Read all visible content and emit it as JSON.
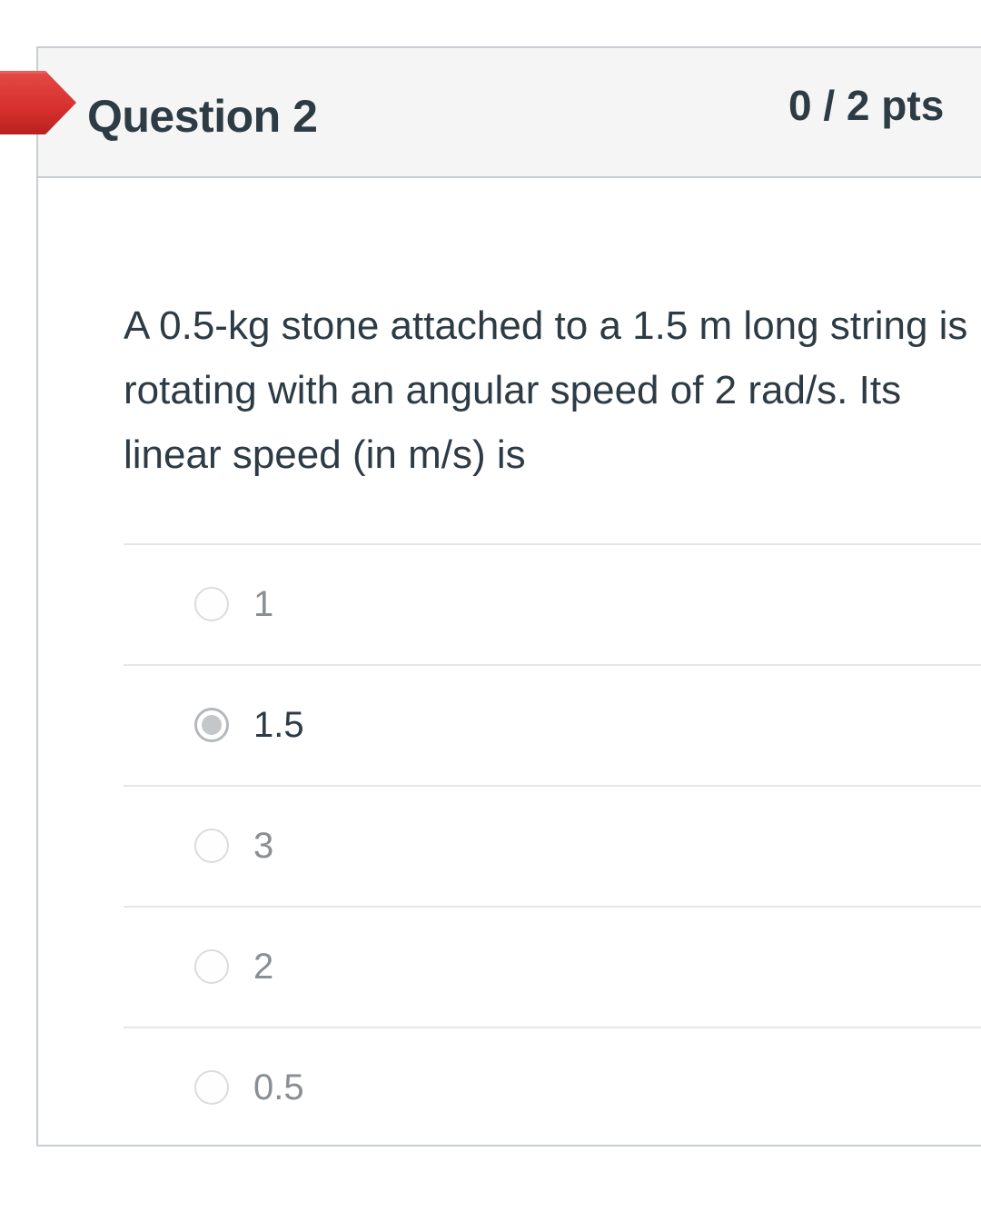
{
  "question": {
    "title": "Question 2",
    "points": "0 / 2 pts",
    "text": "A 0.5-kg stone attached to a 1.5 m long string is rotating with an angular speed of 2 rad/s. Its linear speed (in m/s) is",
    "status_flag_color": "#d93b37"
  },
  "answers": [
    {
      "label": "1",
      "selected": false
    },
    {
      "label": "1.5",
      "selected": true
    },
    {
      "label": "3",
      "selected": false
    },
    {
      "label": "2",
      "selected": false
    },
    {
      "label": "0.5",
      "selected": false
    }
  ]
}
